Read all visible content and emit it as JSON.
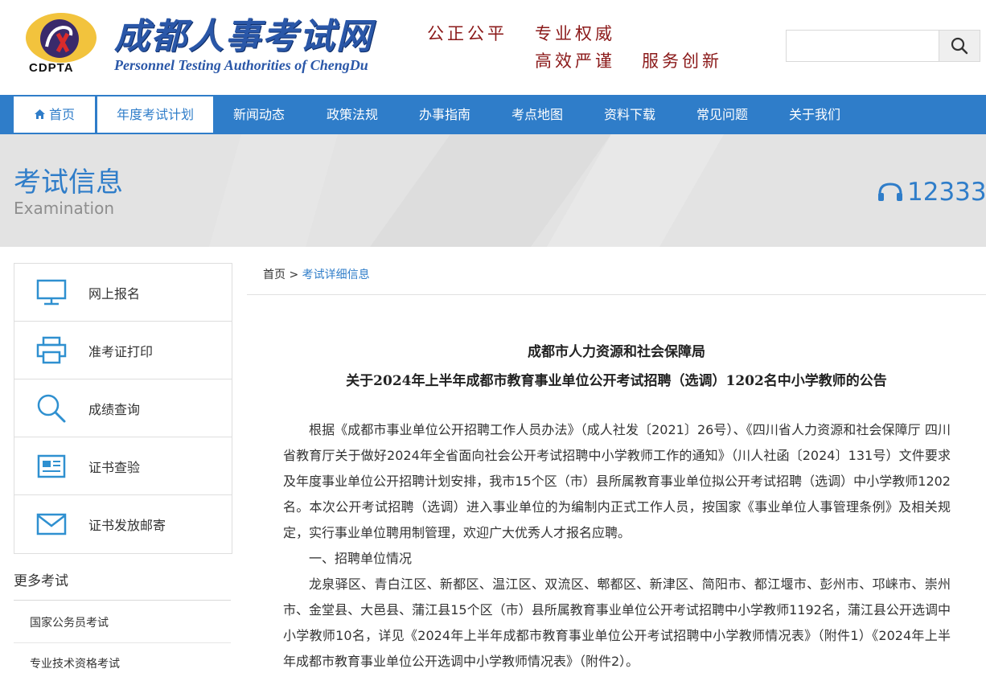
{
  "header": {
    "logo_title": "成都人事考试网",
    "logo_subtitle": "Personnel Testing Authorities of ChengDu",
    "logo_abbr": "CDPTA",
    "slogans": [
      "公正公平",
      "专业权威",
      "高效严谨",
      "服务创新"
    ],
    "search_placeholder": "",
    "search_icon": "search-icon"
  },
  "nav": {
    "items": [
      "首页",
      "年度考试计划",
      "新闻动态",
      "政策法规",
      "办事指南",
      "考点地图",
      "资料下载",
      "常见问题",
      "关于我们"
    ]
  },
  "banner": {
    "title": "考试信息",
    "subtitle": "Examination",
    "hotline": "12333"
  },
  "sidebar": {
    "items": [
      {
        "label": "网上报名",
        "icon": "monitor-icon"
      },
      {
        "label": "准考证打印",
        "icon": "printer-icon"
      },
      {
        "label": "成绩查询",
        "icon": "search-icon"
      },
      {
        "label": "证书查验",
        "icon": "certificate-icon"
      },
      {
        "label": "证书发放邮寄",
        "icon": "mail-icon"
      }
    ],
    "more_title": "更多考试",
    "more_items": [
      "国家公务员考试",
      "专业技术资格考试"
    ]
  },
  "breadcrumb": {
    "home": "首页",
    "separator": ">",
    "current": "考试详细信息"
  },
  "article": {
    "title_line1": "成都市人力资源和社会保障局",
    "title_line2": "关于2024年上半年成都市教育事业单位公开考试招聘（选调）1202名中小学教师的公告",
    "para1": "根据《成都市事业单位公开招聘工作人员办法》（成人社发〔2021〕26号）、《四川省人力资源和社会保障厅 四川省教育厅关于做好2024年全省面向社会公开考试招聘中小学教师工作的通知》（川人社函〔2024〕131号）文件要求及年度事业单位公开招聘计划安排，我市15个区（市）县所属教育事业单位拟公开考试招聘（选调）中小学教师1202名。本次公开考试招聘（选调）进入事业单位的为编制内正式工作人员，按国家《事业单位人事管理条例》及相关规定，实行事业单位聘用制管理，欢迎广大优秀人才报名应聘。",
    "section1": "一、招聘单位情况",
    "para2": "龙泉驿区、青白江区、新都区、温江区、双流区、郫都区、新津区、简阳市、都江堰市、彭州市、邛崃市、崇州市、金堂县、大邑县、蒲江县15个区（市）县所属教育事业单位公开考试招聘中小学教师1192名，蒲江县公开选调中小学教师10名，详见《2024年上半年成都市教育事业单位公开考试招聘中小学教师情况表》（附件1）《2024年上半年成都市教育事业单位公开选调中小学教师情况表》（附件2）。"
  },
  "colors": {
    "primary": "#2f7dc9",
    "slogan": "#8b1a1a",
    "banner_bg": "#e3e3e3"
  }
}
